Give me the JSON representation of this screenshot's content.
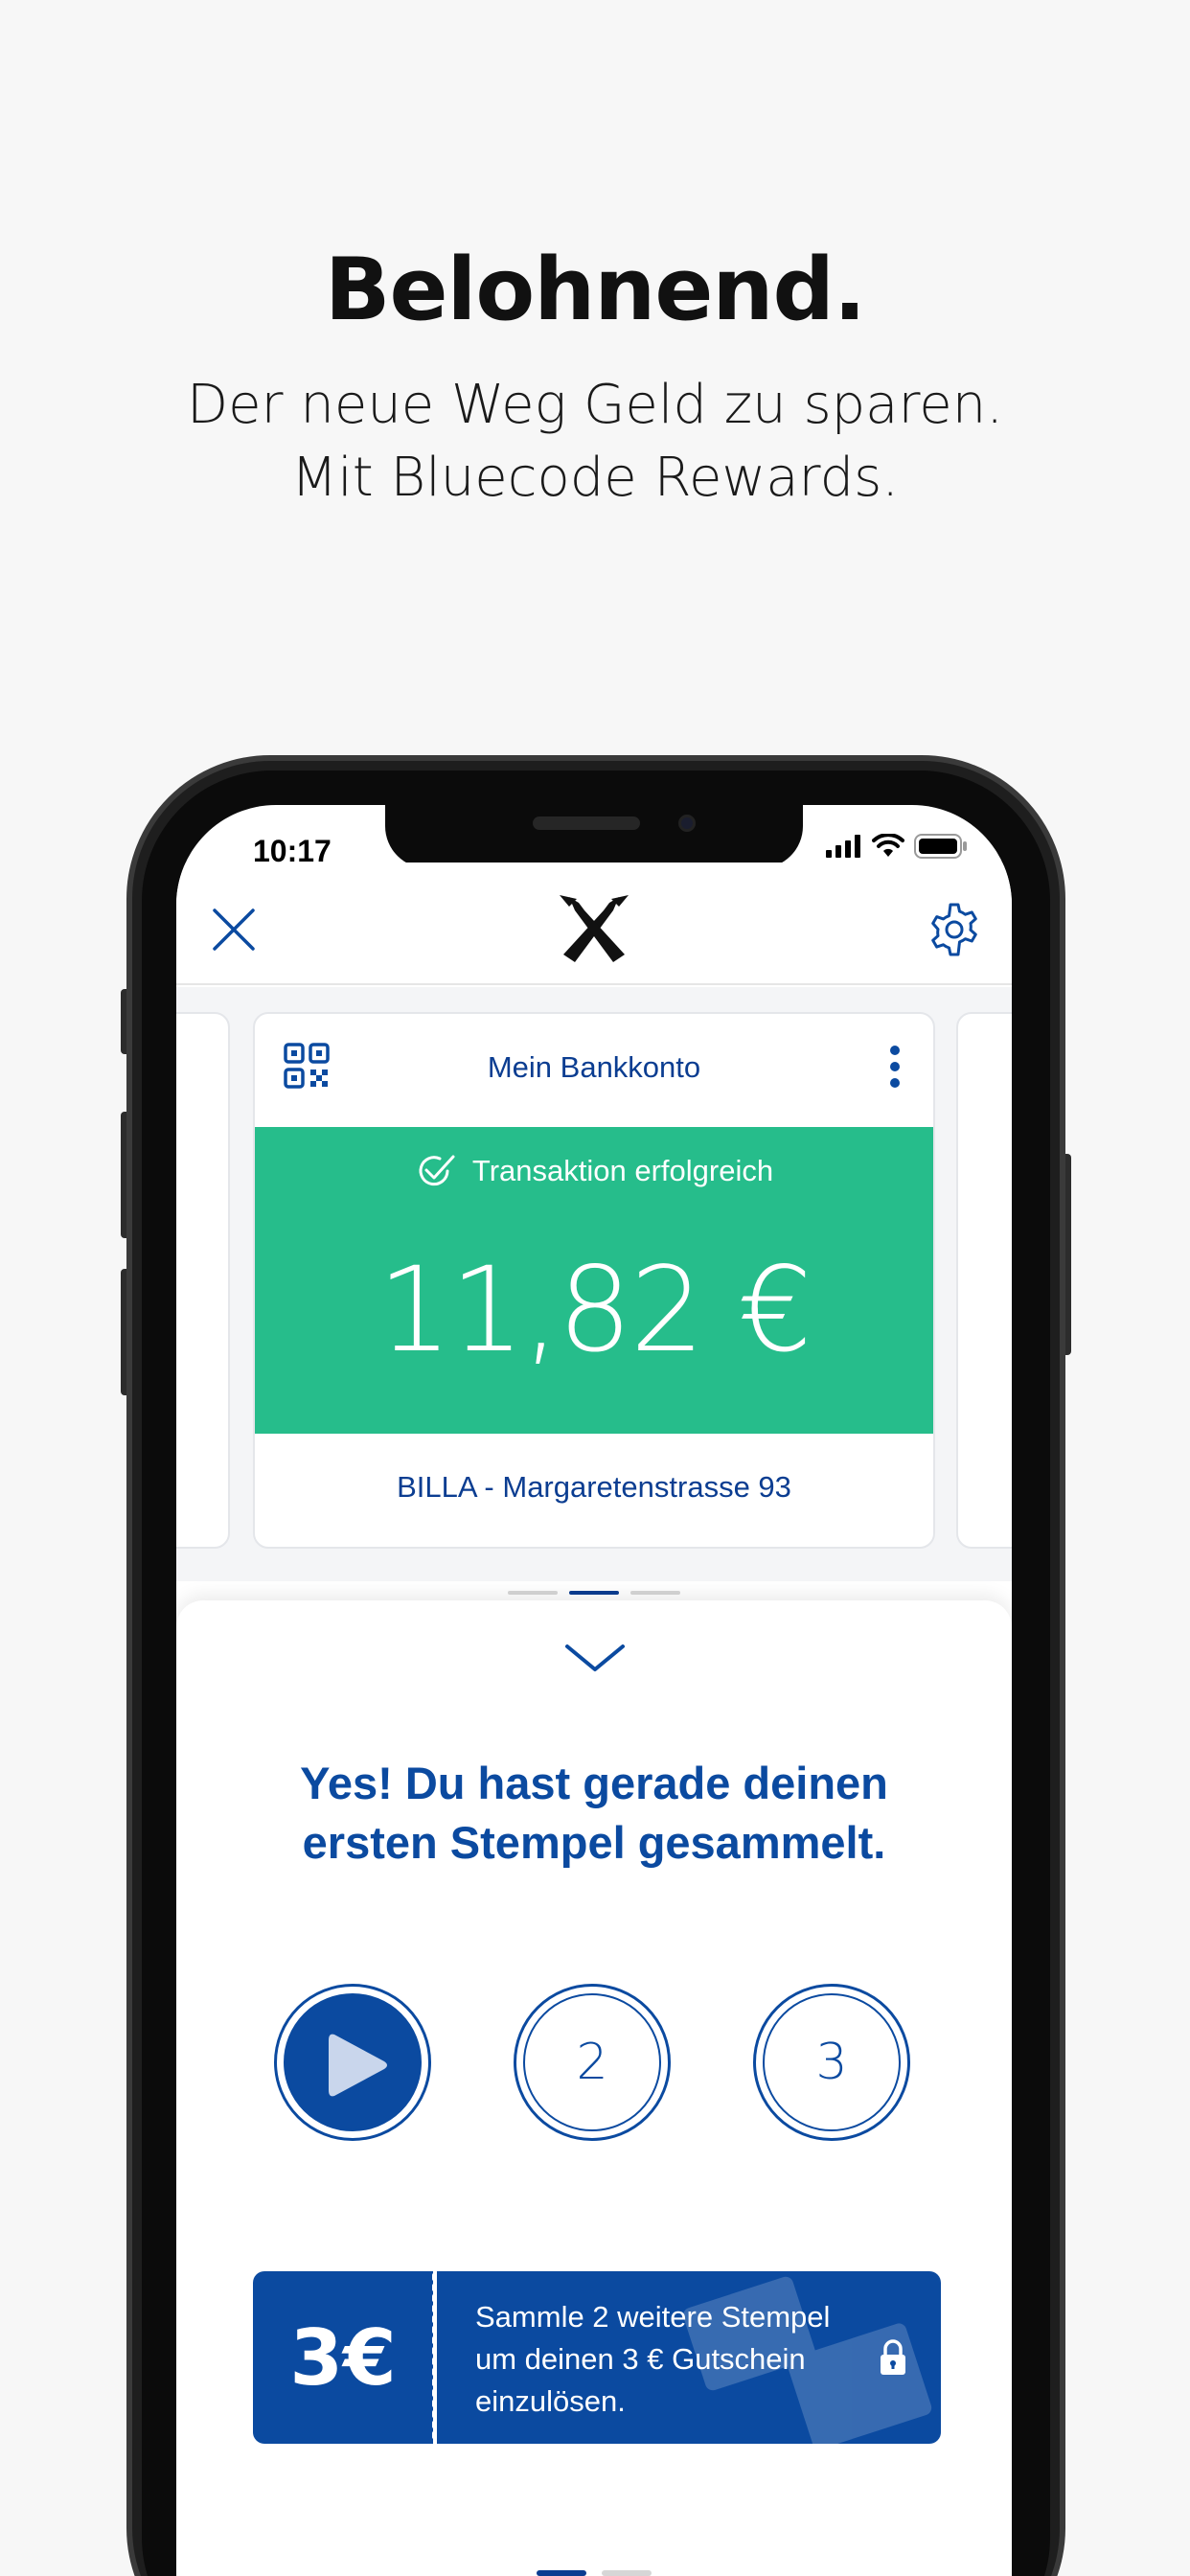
{
  "promo": {
    "headline": "Belohnend.",
    "subline_1": "Der neue Weg Geld zu sparen.",
    "subline_2": "Mit Bluecode Rewards."
  },
  "status_bar": {
    "time": "10:17"
  },
  "app_bar": {
    "close_icon": "close-icon",
    "logo": "raiffeisen-gable-logo",
    "settings_icon": "gear-icon"
  },
  "card": {
    "title": "Mein Bankkonto",
    "qr_icon": "qr-code-icon",
    "more_icon": "more-vertical-icon",
    "status": "Transaktion erfolgreich",
    "amount": "11,82 €",
    "merchant": "BILLA - Margaretenstrasse 93",
    "success_color": "#26bd8b"
  },
  "card_pager": {
    "count": 3,
    "active_index": 1
  },
  "rewards": {
    "message_1": "Yes! Du hast gerade deinen",
    "message_2": "ersten Stempel gesammelt.",
    "stamps": [
      {
        "label": "",
        "collected": true
      },
      {
        "label": "2",
        "collected": false
      },
      {
        "label": "3",
        "collected": false
      }
    ],
    "coupon": {
      "value": "3€",
      "text_1": "Sammle 2 weitere Stempel",
      "text_2": "um deinen 3 € Gutschein",
      "text_3": "einzulösen.",
      "locked": true
    },
    "pager": {
      "count": 2,
      "active_index": 0
    }
  },
  "colors": {
    "brand_blue": "#0b4aa0",
    "text_blue": "#0b3d91",
    "background": "#f7f7f7"
  }
}
